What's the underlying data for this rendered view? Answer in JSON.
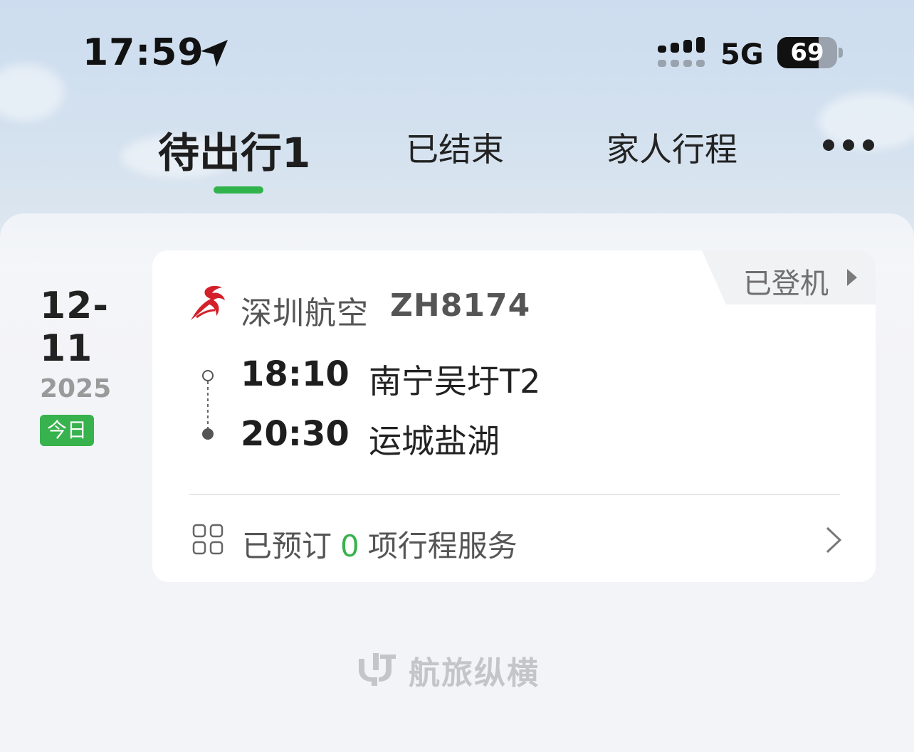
{
  "status_bar": {
    "time": "17:59",
    "network": "5G",
    "battery": "69",
    "battery_level": 0.69
  },
  "tabs": {
    "upcoming": "待出行1",
    "ended": "已结束",
    "family": "家人行程"
  },
  "trip": {
    "date": "12-11",
    "year": "2025",
    "today_badge": "今日",
    "status": "已登机",
    "airline": "深圳航空",
    "flight_no": "ZH8174",
    "departure": {
      "time": "18:10",
      "airport": "南宁吴圩T2"
    },
    "arrival": {
      "time": "20:30",
      "airport": "运城盐湖"
    },
    "services": {
      "prefix": "已预订",
      "count": "0",
      "suffix": "项行程服务"
    }
  },
  "footer": {
    "brand": "航旅纵横"
  },
  "colors": {
    "accent_green": "#2fb34a",
    "airline_red": "#d4202a",
    "brand_gray": "#c3c5c9"
  },
  "icons": {
    "location": "location-arrow-icon",
    "signal": "cellular-signal-icon",
    "battery": "battery-icon",
    "more": "more-dots-icon",
    "airline": "shenzhen-airlines-logo",
    "services": "grid-icon",
    "chevron": "chevron-right-icon"
  }
}
